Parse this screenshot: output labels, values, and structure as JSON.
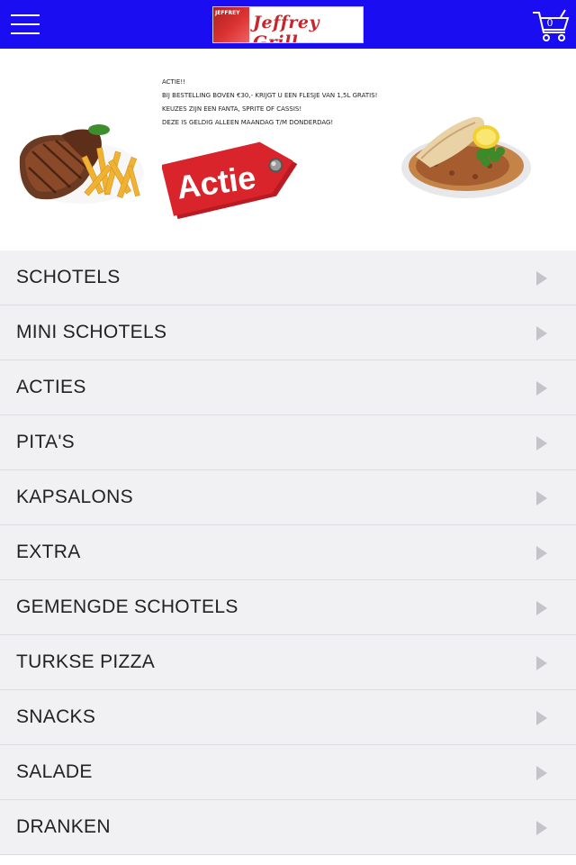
{
  "header": {
    "logo_text": "Jeffrey Grill",
    "logo_badge": "JEFFREY",
    "cart_count": "0",
    "bar_color": "#1a0df2"
  },
  "banner": {
    "lines": [
      "ACTIE!!",
      "BIJ BESTELLING BOVEN €30,- KRIJGT U EEN FLESJE VAN 1,5L GRATIS!",
      "KEUZES ZIJN EEN FANTA, SPRITE OF CASSIS!",
      "DEZE IS GELDIG ALLEEN MAANDAG T/M DONDERDAG!"
    ],
    "tag_label": "Actie",
    "tag_color": "#d8242a"
  },
  "menu": {
    "items": [
      {
        "label": "SCHOTELS"
      },
      {
        "label": "MINI SCHOTELS"
      },
      {
        "label": "ACTIES"
      },
      {
        "label": "PITA'S"
      },
      {
        "label": "KAPSALONS"
      },
      {
        "label": "EXTRA"
      },
      {
        "label": "GEMENGDE SCHOTELS"
      },
      {
        "label": "TURKSE PIZZA"
      },
      {
        "label": "SNACKS"
      },
      {
        "label": "SALADE"
      },
      {
        "label": "DRANKEN"
      }
    ]
  }
}
